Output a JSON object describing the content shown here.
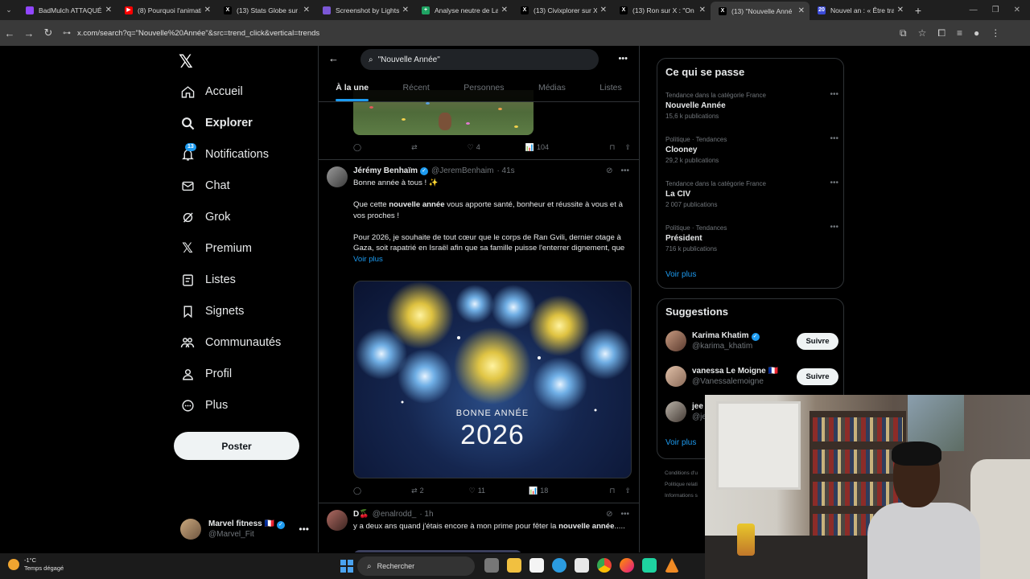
{
  "browser": {
    "tabs": [
      {
        "title": "BadMulch ATTAQUÉ",
        "favicon_color": "#9146ff"
      },
      {
        "title": "(8) Pourquoi l'animati",
        "favicon_color": "#ff0000"
      },
      {
        "title": "(13) Stats Globe sur X",
        "favicon_color": "#000000"
      },
      {
        "title": "Screenshot by Lightsh",
        "favicon_color": "#7b57d6"
      },
      {
        "title": "Analyse neutre de La",
        "favicon_color": "#1fa463"
      },
      {
        "title": "(13) Civixplorer sur X",
        "favicon_color": "#000000"
      },
      {
        "title": "(13) Ron sur X : \"On a",
        "favicon_color": "#000000"
      },
      {
        "title": "(13) \"Nouvelle Anné",
        "favicon_color": "#000000",
        "active": true
      },
      {
        "title": "Nouvel an : « Être tra",
        "favicon_color": "#3b4bd8"
      }
    ],
    "url": "x.com/search?q=\"Nouvelle%20Année\"&src=trend_click&vertical=trends"
  },
  "sidebar": {
    "logo": "𝕏",
    "items": [
      {
        "label": "Accueil",
        "icon": "home-icon"
      },
      {
        "label": "Explorer",
        "icon": "search-icon",
        "active": true
      },
      {
        "label": "Notifications",
        "icon": "bell-icon",
        "badge": "13"
      },
      {
        "label": "Chat",
        "icon": "mail-icon"
      },
      {
        "label": "Grok",
        "icon": "grok-icon"
      },
      {
        "label": "Premium",
        "icon": "x-premium-icon"
      },
      {
        "label": "Listes",
        "icon": "list-icon"
      },
      {
        "label": "Signets",
        "icon": "bookmark-icon"
      },
      {
        "label": "Communautés",
        "icon": "communities-icon"
      },
      {
        "label": "Profil",
        "icon": "profile-icon"
      },
      {
        "label": "Plus",
        "icon": "more-circle-icon"
      }
    ],
    "post_button": "Poster",
    "account": {
      "name": "Marvel fitness 🇫🇷",
      "handle": "@Marvel_Fit"
    }
  },
  "search": {
    "query": "\"Nouvelle Année\"",
    "tabs": [
      "À la une",
      "Récent",
      "Personnes",
      "Médias",
      "Listes"
    ],
    "active_tab": "À la une"
  },
  "tweets": [
    {
      "stats": {
        "reply": "",
        "retweet": "",
        "like": "4",
        "views": "104"
      }
    },
    {
      "name": "Jérémy Benhaïm",
      "handle": "@JeremBenhaim",
      "time": "· 41s",
      "line1": "Bonne année à tous ! ✨",
      "line2_pre": "Que cette ",
      "line2_bold": "nouvelle année",
      "line2_post": " vous apporte santé, bonheur et réussite à vous et à vos proches !",
      "line3": "Pour 2026, je souhaite de tout cœur que le corps de Ran Gvili, dernier otage à Gaza, soit rapatrié en Israël afin que sa famille puisse l'enterrer dignement, que",
      "show_more": "Voir plus",
      "image_text1": "BONNE ANNÉE",
      "image_text2": "2026",
      "stats": {
        "reply": "",
        "retweet": "2",
        "like": "11",
        "views": "18"
      }
    },
    {
      "name": "D🍒",
      "handle": "@enalrodd_",
      "time": "· 1h",
      "text_pre": "y a deux ans quand j'étais encore à mon prime pour fêter la ",
      "text_bold": "nouvelle année",
      "text_post": "....."
    }
  ],
  "trends_box": {
    "title": "Ce qui se passe",
    "items": [
      {
        "category": "Tendance dans la catégorie France",
        "name": "Nouvelle Année",
        "count": "15,6 k publications"
      },
      {
        "category": "Politique · Tendances",
        "name": "Clooney",
        "count": "29,2 k publications"
      },
      {
        "category": "Tendance dans la catégorie France",
        "name": "La CIV",
        "count": "2 007 publications"
      },
      {
        "category": "Politique · Tendances",
        "name": "Président",
        "count": "716 k publications"
      }
    ],
    "show_more": "Voir plus"
  },
  "suggestions_box": {
    "title": "Suggestions",
    "items": [
      {
        "name": "Karima Khatim",
        "handle": "@karima_khatim",
        "button": "Suivre"
      },
      {
        "name": "vanessa Le Moigne 🇫🇷",
        "handle": "@Vanessalemoigne",
        "button": "Suivre"
      },
      {
        "name": "jee",
        "handle": "@je"
      }
    ],
    "show_more": "Voir plus"
  },
  "footer_links": [
    "Conditions d'u",
    "Politique relati",
    "Informations s"
  ],
  "taskbar": {
    "temperature": "-1°C",
    "weather": "Temps dégagé",
    "search_label": "Rechercher"
  }
}
